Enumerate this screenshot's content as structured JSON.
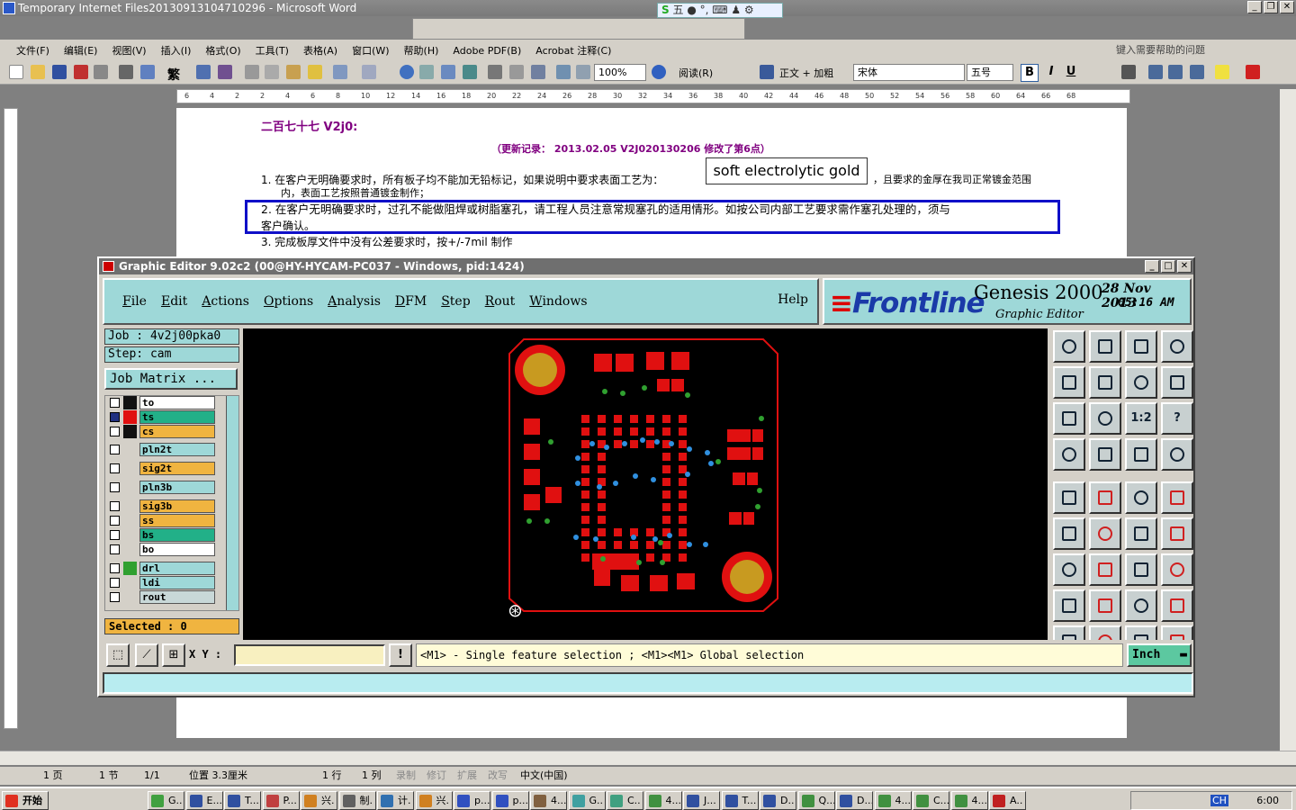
{
  "word": {
    "title": "Temporary Internet Files20130913104710296 - Microsoft Word",
    "menu": [
      "文件(F)",
      "编辑(E)",
      "视图(V)",
      "插入(I)",
      "格式(O)",
      "工具(T)",
      "表格(A)",
      "窗口(W)",
      "帮助(H)",
      "Adobe PDF(B)",
      "Acrobat 注释(C)"
    ],
    "help_placeholder": "键入需要帮助的问题",
    "toolbar": {
      "traditional": "繁",
      "zoom": "100%",
      "read": "阅读(R)",
      "style": "正文 + 加粗",
      "font": "宋体",
      "size": "五号",
      "bold": "B",
      "italic": "I",
      "underline": "U"
    },
    "ruler_ticks": [
      "6",
      "4",
      "2",
      "2",
      "4",
      "6",
      "8",
      "10",
      "12",
      "14",
      "16",
      "18",
      "20",
      "22",
      "24",
      "26",
      "28",
      "30",
      "32",
      "34",
      "36",
      "38",
      "40",
      "42",
      "44",
      "46",
      "48",
      "50",
      "52",
      "54",
      "56",
      "58",
      "60",
      "64",
      "66",
      "68"
    ],
    "doc": {
      "heading": "二百七十七 V2j0:",
      "update": "（更新记录：  2013.02.05      V2J020130206          修改了第6点）",
      "item1a": "1.  在客户无明确要求时，所有板子均不能加无铅标记，如果说明中要求表面工艺为：",
      "item1b": "，且要求的金厚在我司正常镀金范围",
      "item1c": "内，表面工艺按照普通镀金制作；",
      "item2a": "2.  在客户无明确要求时，过孔不能做阻焊或树脂塞孔，请工程人员注意常规塞孔的适用情形。如按公司内部工艺要求需作塞孔处理的，须与",
      "item2b": "客户确认。",
      "item3": "3.   完成板厚文件中没有公差要求时，按+/-7mil 制作",
      "callout": "soft electrolytic gold"
    },
    "status": {
      "page": "1 页",
      "section": "1 节",
      "pages": "1/1",
      "position": "位置 3.3厘米",
      "line": "1 行",
      "col": "1 列",
      "rec": "录制",
      "trk": "修订",
      "ext": "扩展",
      "ovr": "改写",
      "lang": "中文(中国)"
    }
  },
  "ime": "五",
  "genesis": {
    "title": "Graphic Editor 9.02c2 (00@HY-HYCAM-PC037 - Windows, pid:1424)",
    "menu": [
      "File",
      "Edit",
      "Actions",
      "Options",
      "Analysis",
      "DFM",
      "Step",
      "Rout",
      "Windows"
    ],
    "help": "Help",
    "logo": {
      "brand": "Frontline",
      "product": "Genesis 2000",
      "sub": "Graphic Editor",
      "date": "28 Nov 2013",
      "time": "05:16 AM"
    },
    "job": "Job : 4v2j00pka0",
    "step": "Step: cam",
    "matrix": "Job Matrix ...",
    "layers": [
      {
        "name": "to",
        "color": "#ffffff"
      },
      {
        "name": "ts",
        "color": "#22b088"
      },
      {
        "name": "cs",
        "color": "#f0b440"
      },
      {
        "name": "pln2t",
        "color": "#9ed8d8"
      },
      {
        "name": "sig2t",
        "color": "#f0b440"
      },
      {
        "name": "pln3b",
        "color": "#9ed8d8"
      },
      {
        "name": "sig3b",
        "color": "#f0b440"
      },
      {
        "name": "ss",
        "color": "#f0b440"
      },
      {
        "name": "bs",
        "color": "#22b088"
      },
      {
        "name": "bo",
        "color": "#ffffff"
      },
      {
        "name": "drl",
        "color": "#9ed8d8"
      },
      {
        "name": "ldi",
        "color": "#9ed8d8"
      },
      {
        "name": "rout",
        "color": "#c8d8d8"
      }
    ],
    "selected": "Selected : 0",
    "xy_label": "X Y :",
    "message": "<M1> - Single feature selection ; <M1><M1> Global selection",
    "units": "Inch",
    "tool_labels": {
      "ratio": "1:2",
      "query": "?"
    }
  },
  "taskbar": {
    "start": "开始",
    "tasks": [
      "G..",
      "E...",
      "T...",
      "P...",
      "兴.",
      "制.",
      "计.",
      "兴.",
      "p...",
      "p...",
      "4...",
      "G..",
      "C..",
      "4...",
      "J...",
      "T...",
      "D..",
      "Q...",
      "D...",
      "4...",
      "C...",
      "4...",
      "A.."
    ],
    "time": "6:00",
    "lang": "CH"
  }
}
